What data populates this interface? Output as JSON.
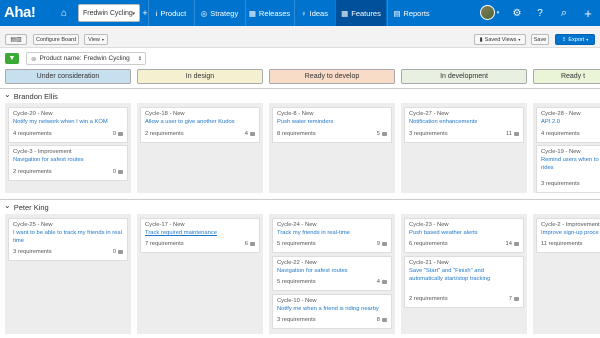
{
  "app": {
    "logo": "Aha!"
  },
  "nav": {
    "workspace": "Fredwin Cycling",
    "items": [
      {
        "label": "Product",
        "icon": "info-icon"
      },
      {
        "label": "Strategy",
        "icon": "target-icon"
      },
      {
        "label": "Releases",
        "icon": "calendar-icon"
      },
      {
        "label": "Ideas",
        "icon": "lightbulb-icon"
      },
      {
        "label": "Features",
        "icon": "grid-icon"
      },
      {
        "label": "Reports",
        "icon": "chart-icon"
      }
    ],
    "glyphs": {
      "home": "⌂",
      "settings": "⚙",
      "help": "?",
      "search": "⌕",
      "add": "+",
      "caret": "▾",
      "info": "i",
      "target": "◎",
      "calendar": "▦",
      "lightbulb": "♀",
      "grid": "▦",
      "report": "▤"
    }
  },
  "toolbar": {
    "configure_board": "Configure Board",
    "view": "View",
    "saved_views": "Saved Views",
    "save": "Save",
    "export": "Export"
  },
  "filter": {
    "label": "Product name: Fredwin Cycling"
  },
  "columns": [
    {
      "label": "Under consideration",
      "color": "#c7e0f0"
    },
    {
      "label": "In design",
      "color": "#f5f0d0"
    },
    {
      "label": "Ready to develop",
      "color": "#f9dcc8"
    },
    {
      "label": "In development",
      "color": "#e8f0e2"
    },
    {
      "label": "Ready t",
      "color": "#eaf5d8"
    }
  ],
  "groups": [
    {
      "name": "Brandon Ellis",
      "cards": [
        {
          "col": 0,
          "id": "Cycle-20 - New",
          "title": "Notify my network when I win a KOM",
          "meta": "4 requirements",
          "count": "0"
        },
        {
          "col": 0,
          "id": "Cycle-3 - Improvement",
          "title": "Navigation for safest routes",
          "meta": "2 requirements",
          "count": "0"
        },
        {
          "col": 1,
          "id": "Cycle-18 - New",
          "title": "Allow a user to give another Kudos",
          "meta": "2 requirements",
          "count": "4"
        },
        {
          "col": 2,
          "id": "Cycle-8 - New",
          "title": "Push water reminders",
          "meta": "8 requirements",
          "count": "5"
        },
        {
          "col": 3,
          "id": "Cycle-27 - New",
          "title": "Notification enhancements",
          "meta": "3 requirements",
          "count": "11"
        },
        {
          "col": 4,
          "id": "Cycle-28 - New",
          "title": "API 2.0",
          "meta": "4 requirements",
          "count": ""
        },
        {
          "col": 4,
          "id": "Cycle-19 - New",
          "title": "Remind users when to rides",
          "meta": "3 requirements",
          "count": ""
        }
      ]
    },
    {
      "name": "Peter King",
      "cards": [
        {
          "col": 0,
          "id": "Cycle-25 - New",
          "title": "I want to be able to track my friends in real time",
          "meta": "3 requirements",
          "count": "0"
        },
        {
          "col": 1,
          "id": "Cycle-17 - New",
          "title": "Track required maintenance",
          "meta": "7 requirements",
          "count": "6"
        },
        {
          "col": 2,
          "id": "Cycle-24 - New",
          "title": "Track my friends in real-time",
          "meta": "5 requirements",
          "count": "9"
        },
        {
          "col": 2,
          "id": "Cycle-22 - New",
          "title": "Navigation for safest routes",
          "meta": "5 requirements",
          "count": "4"
        },
        {
          "col": 2,
          "id": "Cycle-10 - New",
          "title": "Notify me when a friend is riding nearby",
          "meta": "3 requirements",
          "count": "8"
        },
        {
          "col": 3,
          "id": "Cycle-23 - New",
          "title": "Push based weather alerts",
          "meta": "6 requirements",
          "count": "14"
        },
        {
          "col": 3,
          "id": "Cycle-21 - New",
          "title": "Save \"Start\" and \"Finish\" and automatically start/stop tracking",
          "meta": "2 requirements",
          "count": "7"
        },
        {
          "col": 4,
          "id": "Cycle-2 - Improvement",
          "title": "Improve sign-up proce",
          "meta": "11 requirements",
          "count": ""
        }
      ]
    }
  ]
}
